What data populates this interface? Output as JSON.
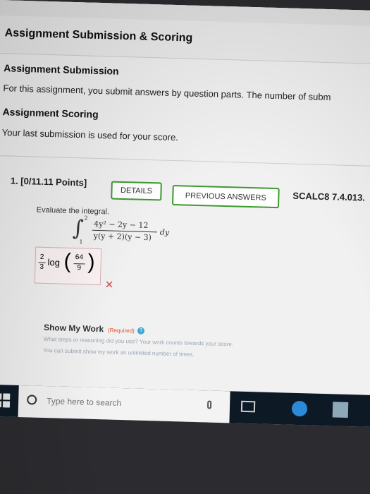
{
  "page": {
    "title": "Assignment Submission & Scoring",
    "submission_heading": "Assignment Submission",
    "submission_text": "For this assignment, you submit answers by question parts. The number of subm",
    "scoring_heading": "Assignment Scoring",
    "scoring_text": "Your last submission is used for your score."
  },
  "question": {
    "number_points": "1.  [0/11.11 Points]",
    "details_label": "DETAILS",
    "previous_answers_label": "PREVIOUS ANSWERS",
    "code": "SCALC8 7.4.013.",
    "prompt": "Evaluate the integral.",
    "integral": {
      "upper": "2",
      "lower": "1",
      "numerator": "4y² − 2y − 12",
      "denominator": "y(y + 2)(y − 3)",
      "differential": "dy"
    },
    "answer": {
      "coef_num": "2",
      "coef_den": "3",
      "func": "log",
      "arg_num": "64",
      "arg_den": "9"
    },
    "incorrect_mark": "✕"
  },
  "show_work": {
    "label": "Show My Work",
    "required": "(Required)",
    "help": "?",
    "line1": "What steps or reasoning did you use? Your work counts towards your score.",
    "line2": "You can submit show my work an unlimited number of times."
  },
  "taskbar": {
    "search_placeholder": "Type here to search"
  },
  "colors": {
    "accent_green": "#3d9a2e",
    "error_red": "#d94a4a",
    "taskbar": "#0d1a26"
  }
}
